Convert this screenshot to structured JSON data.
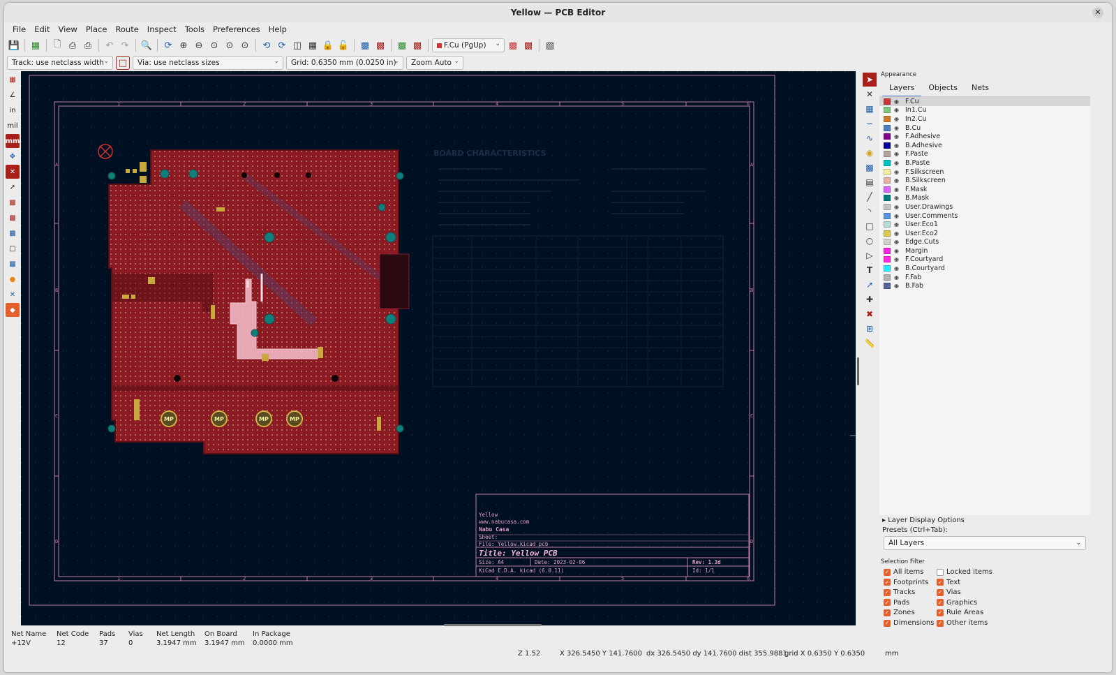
{
  "window": {
    "title": "Yellow — PCB Editor",
    "close_glyph": "✕"
  },
  "menu": [
    "File",
    "Edit",
    "View",
    "Place",
    "Route",
    "Inspect",
    "Tools",
    "Preferences",
    "Help"
  ],
  "toolbar": {
    "layer_combo": "F.Cu (PgUp)",
    "track_combo": "Track: use netclass width",
    "via_combo": "Via: use netclass sizes",
    "grid_combo": "Grid: 0.6350 mm (0.0250 in)",
    "zoom_combo": "Zoom Auto"
  },
  "left_toolbar": {
    "in_label": "in",
    "mil_label": "mil",
    "mm_label": "mm"
  },
  "appearance": {
    "title": "Appearance",
    "tabs": [
      "Layers",
      "Objects",
      "Nets"
    ],
    "layers": [
      {
        "name": "F.Cu",
        "color": "#c83434"
      },
      {
        "name": "In1.Cu",
        "color": "#7fc87f"
      },
      {
        "name": "In2.Cu",
        "color": "#ce7d2c"
      },
      {
        "name": "B.Cu",
        "color": "#4d7fc4"
      },
      {
        "name": "F.Adhesive",
        "color": "#84008d"
      },
      {
        "name": "B.Adhesive",
        "color": "#0000a0"
      },
      {
        "name": "F.Paste",
        "color": "#b4a09f"
      },
      {
        "name": "B.Paste",
        "color": "#00c2c2"
      },
      {
        "name": "F.Silkscreen",
        "color": "#f2eda1"
      },
      {
        "name": "B.Silkscreen",
        "color": "#e8b2a7"
      },
      {
        "name": "F.Mask",
        "color": "#d864ff"
      },
      {
        "name": "B.Mask",
        "color": "#027d7d"
      },
      {
        "name": "User.Drawings",
        "color": "#c2c2c2"
      },
      {
        "name": "User.Comments",
        "color": "#5994dc"
      },
      {
        "name": "User.Eco1",
        "color": "#b4dbd2"
      },
      {
        "name": "User.Eco2",
        "color": "#d8c852"
      },
      {
        "name": "Edge.Cuts",
        "color": "#d0d2cd"
      },
      {
        "name": "Margin",
        "color": "#ff26e2"
      },
      {
        "name": "F.Courtyard",
        "color": "#ff26e2"
      },
      {
        "name": "B.Courtyard",
        "color": "#26e9ff"
      },
      {
        "name": "F.Fab",
        "color": "#afafaf"
      },
      {
        "name": "B.Fab",
        "color": "#58659b"
      }
    ],
    "layer_display_options": "Layer Display Options",
    "presets_label": "Presets (Ctrl+Tab):",
    "presets_value": "All Layers",
    "selection_filter_label": "Selection Filter",
    "filters_left": [
      {
        "label": "All items",
        "checked": true
      },
      {
        "label": "Footprints",
        "checked": true
      },
      {
        "label": "Tracks",
        "checked": true
      },
      {
        "label": "Pads",
        "checked": true
      },
      {
        "label": "Zones",
        "checked": true
      },
      {
        "label": "Dimensions",
        "checked": true
      }
    ],
    "filters_right": [
      {
        "label": "Locked items",
        "checked": false
      },
      {
        "label": "Text",
        "checked": true
      },
      {
        "label": "Vias",
        "checked": true
      },
      {
        "label": "Graphics",
        "checked": true
      },
      {
        "label": "Rule Areas",
        "checked": true
      },
      {
        "label": "Other items",
        "checked": true
      }
    ]
  },
  "canvas": {
    "board_char_title": "BOARD CHARACTERISTICS",
    "title_block": {
      "company": "Yellow",
      "url": "www.nabucasa.com",
      "org": "Nabu Casa",
      "sheet": "Sheet:",
      "file": "File: Yellow.kicad_pcb",
      "title": "Title: Yellow PCB",
      "size": "Size: A4",
      "date": "Date: 2023-02-06",
      "rev": "Rev: 1.3d",
      "kicad": "KiCad E.D.A.  kicad (6.0.11)",
      "id": "Id: 1/1"
    },
    "frame_cols": [
      "1",
      "2",
      "3",
      "4",
      "5",
      "6"
    ],
    "frame_rows": [
      "A",
      "B",
      "C",
      "D"
    ],
    "mounting_label": "MP"
  },
  "msgpanel": [
    {
      "label": "Net Name",
      "value": "+12V"
    },
    {
      "label": "Net Code",
      "value": "12"
    },
    {
      "label": "Pads",
      "value": "37"
    },
    {
      "label": "Vias",
      "value": "0"
    },
    {
      "label": "Net Length",
      "value": "3.1947 mm"
    },
    {
      "label": "On Board",
      "value": "3.1947 mm"
    },
    {
      "label": "In Package",
      "value": "0.0000 mm"
    }
  ],
  "status": {
    "zoom": "Z 1.52",
    "xy": "X 326.5450  Y 141.7600",
    "delta": "dx 326.5450  dy 141.7600  dist 355.9881",
    "grid": "grid X 0.6350  Y 0.6350",
    "units": "mm"
  }
}
